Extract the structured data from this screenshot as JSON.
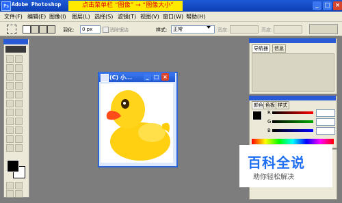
{
  "window": {
    "title": "Adobe Photoshop",
    "hint": "点击菜单栏 “图像” → “图像大小”",
    "min_glyph": "_",
    "max_glyph": "□",
    "close_glyph": "×"
  },
  "menu": [
    "文件(F)",
    "编辑(E)",
    "图像(I)",
    "图层(L)",
    "选择(S)",
    "滤镜(T)",
    "视图(V)",
    "窗口(W)",
    "帮助(H)"
  ],
  "options": {
    "feather_label": "羽化:",
    "feather_value": "0 px",
    "antialias_label": "消除锯齿",
    "style_label": "样式:",
    "style_value": "正常",
    "width_label": "宽度:",
    "height_label": "高度:"
  },
  "document": {
    "title": "(C) 小..."
  },
  "panels": {
    "navigator_tab": "导航器",
    "info_tab": "信息",
    "color_tab": "颜色",
    "swatches_tab": "色板",
    "styles_tab": "样式",
    "r_label": "R",
    "g_label": "G",
    "b_label": "B"
  },
  "colors": {
    "titlebar": "#1f5ad6",
    "hint_bg": "#ffea00",
    "hint_text": "#e00000",
    "workspace": "#7d7d7d",
    "duck_yellow": "#ffd41a",
    "duck_beak": "#ff4a1a"
  },
  "watermark": {
    "big": "百科全说",
    "small": "助你轻松解决"
  }
}
